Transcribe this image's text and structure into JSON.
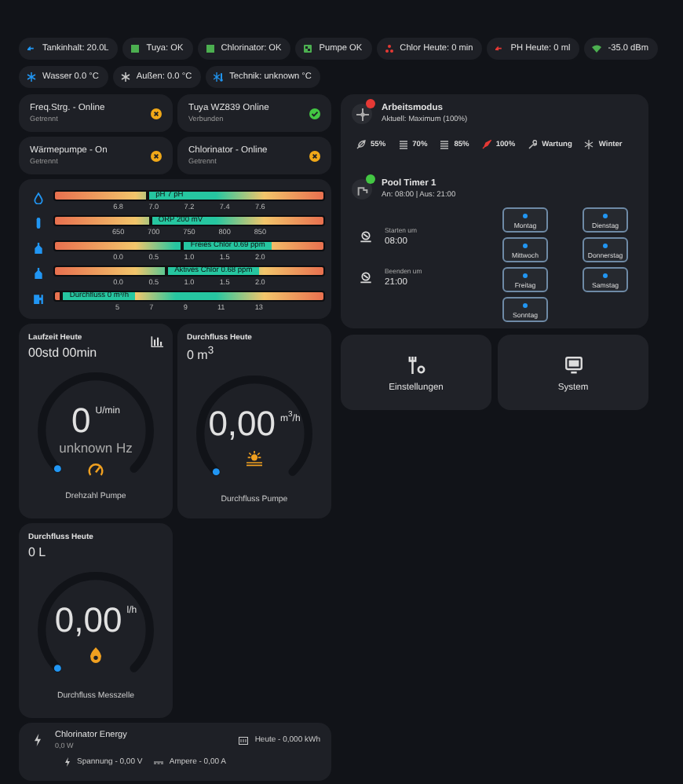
{
  "chips": [
    {
      "label": "Tankinhalt: 20.0L",
      "kind": "tank",
      "color": "#2196f3"
    },
    {
      "label": "Tuya: OK",
      "kind": "square",
      "color": "#4caf50"
    },
    {
      "label": "Chlorinator: OK",
      "kind": "square",
      "color": "#4caf50"
    },
    {
      "label": "Pumpe OK",
      "kind": "pump",
      "color": "#4caf50"
    },
    {
      "label": "Chlor Heute: 0 min",
      "kind": "drops",
      "color": "#e53935"
    },
    {
      "label": "PH Heute: 0 ml",
      "kind": "tank",
      "color": "#e53935"
    },
    {
      "label": "-35.0 dBm",
      "kind": "wifi",
      "color": "#4caf50"
    },
    {
      "label": "Wasser 0.0 °C",
      "kind": "snow",
      "color": "#2196f3"
    },
    {
      "label": "Außen: 0.0 °C",
      "kind": "snow",
      "color": "#c8c8c8"
    },
    {
      "label": "Technik: unknown °C",
      "kind": "thermo",
      "color": "#2196f3"
    }
  ],
  "status_cards": [
    {
      "title": "Freq.Strg. - Online",
      "subtitle": "Getrennt",
      "connected": false
    },
    {
      "title": "Tuya WZ839 Online",
      "subtitle": "Verbunden",
      "connected": true
    },
    {
      "title": "Wärmepumpe - On",
      "subtitle": "Getrennt",
      "connected": false
    },
    {
      "title": "Chlorinator - Online",
      "subtitle": "Getrennt",
      "connected": false
    }
  ],
  "bars": [
    {
      "kind": "drop",
      "label": "pH 7 pH",
      "level": 0.34,
      "ticks": [
        "6.8",
        "7.0",
        "7.2",
        "7.4",
        "7.6"
      ]
    },
    {
      "kind": "probe",
      "label": "ORP 200 mV",
      "level": 0.35,
      "ticks": [
        "650",
        "700",
        "750",
        "800",
        "850"
      ]
    },
    {
      "kind": "bottle",
      "label": "Freies Chlor 0.69 ppm",
      "level": 0.47,
      "ticks": [
        "0.0",
        "0.5",
        "1.0",
        "1.5",
        "2.0"
      ]
    },
    {
      "kind": "bottle",
      "label": "Aktives Chlor 0.68 ppm",
      "level": 0.41,
      "ticks": [
        "0.0",
        "0.5",
        "1.0",
        "1.5",
        "2.0"
      ]
    },
    {
      "kind": "pump",
      "label": "Durchfluss 0 m³/h",
      "level": 0.02,
      "ticks": [
        "5",
        "7",
        "9",
        "11",
        "13"
      ]
    }
  ],
  "gauges": [
    {
      "title": "Laufzeit Heute",
      "value": "00std 00min",
      "chart_button": true,
      "reading": "0",
      "unit": "U/min",
      "sub": "unknown Hz",
      "kind": "speed",
      "label": "Drehzahl Pumpe"
    },
    {
      "title": "Durchfluss Heute",
      "value": "0 m$^{3}$",
      "chart_button": false,
      "reading": "0,00",
      "unit": "m$^{3}$/h",
      "kind": "sun",
      "label": "Durchfluss Pumpe"
    },
    {
      "title": "Durchfluss Heute",
      "value": "0 L",
      "chart_button": false,
      "reading": "0,00",
      "unit": "l/h",
      "kind": "flame",
      "label": "Durchfluss Messzelle"
    }
  ],
  "energy": {
    "title": "Chlorinator Energy",
    "power": "0,0 W",
    "today": "Heute - 0,000 kWh",
    "voltage": "Spannung - 0,00 V",
    "current": "Ampere - 0,00 A"
  },
  "mode": {
    "title": "Arbeitsmodus",
    "subtitle": "Aktuell: Maximum (100%)",
    "options": [
      {
        "label": "55%",
        "kind": "leaf",
        "selected": false
      },
      {
        "label": "70%",
        "kind": "lines",
        "selected": false
      },
      {
        "label": "85%",
        "kind": "lines",
        "selected": false
      },
      {
        "label": "100%",
        "kind": "rocket",
        "selected": true
      },
      {
        "label": "Wartung",
        "kind": "wrench",
        "selected": false
      },
      {
        "label": "Winter",
        "kind": "snow",
        "selected": false
      }
    ]
  },
  "timer": {
    "title": "Pool Timer 1",
    "subtitle": "An: 08:00 | Aus: 21:00",
    "active": true,
    "start_label": "Starten um",
    "start": "08:00",
    "end_label": "Beenden um",
    "end": "21:00",
    "days": [
      {
        "label": "Montag",
        "checked": true
      },
      {
        "label": "Dienstag",
        "checked": true
      },
      {
        "label": "Mittwoch",
        "checked": true
      },
      {
        "label": "Donnerstag",
        "checked": true
      },
      {
        "label": "Freitag",
        "checked": true
      },
      {
        "label": "Samstag",
        "checked": true
      },
      {
        "label": "Sonntag",
        "checked": true
      }
    ]
  },
  "nav_buttons": [
    {
      "label": "Einstellungen",
      "kind": "tools"
    },
    {
      "label": "System",
      "kind": "monitor"
    }
  ]
}
